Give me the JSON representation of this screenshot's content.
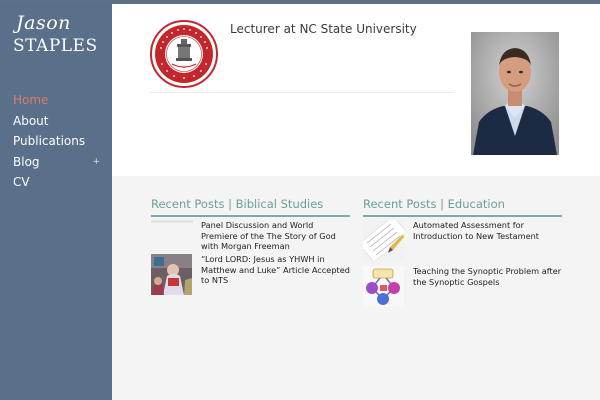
{
  "site": {
    "logo_first": "Jason",
    "logo_last": "STAPLES"
  },
  "nav": [
    {
      "label": "Home",
      "active": true
    },
    {
      "label": "About"
    },
    {
      "label": "Publications"
    },
    {
      "label": "Blog",
      "expander": "+"
    },
    {
      "label": "CV"
    }
  ],
  "header": {
    "tagline": "Lecturer at NC State University",
    "seal_icon": "nc-state-university-seal-icon"
  },
  "recent_biblical": {
    "title": "Recent Posts | Biblical Studies",
    "posts": [
      {
        "title": "Panel Discussion and World Premiere of the The Story of God with Morgan Freeman"
      },
      {
        "title": "“Lord LORD: Jesus as YHWH in Matthew and Luke” Article Accepted to NTS"
      }
    ]
  },
  "recent_education": {
    "title": "Recent Posts | Education",
    "posts": [
      {
        "title": "Automated Assessment for Introduction to New Testament"
      },
      {
        "title": "Teaching the Synoptic Problem after the Synoptic Gospels"
      }
    ]
  },
  "colors": {
    "sidebar": "#5a6f89",
    "nav_active": "#e07a6e",
    "section_accent": "#6b9e9a",
    "seal_red": "#c1272d"
  }
}
